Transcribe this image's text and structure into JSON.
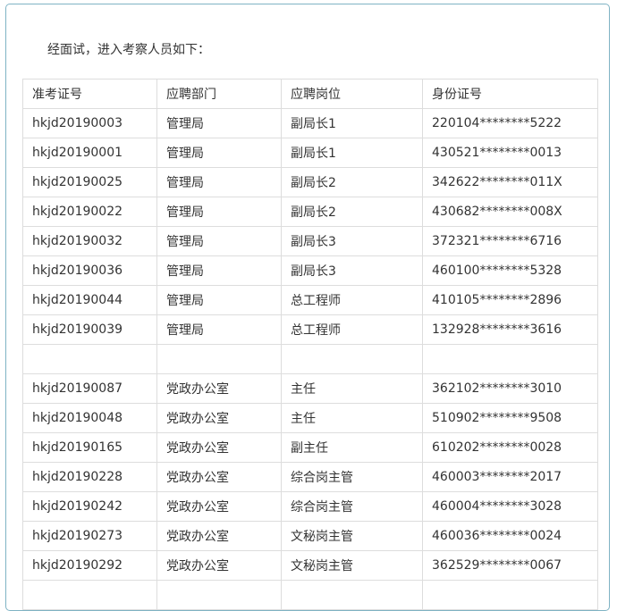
{
  "intro_text": "经面试，进入考察人员如下：",
  "table": {
    "headers": [
      "准考证号",
      "应聘部门",
      "应聘岗位",
      "身份证号"
    ],
    "rows": [
      [
        "hkjd20190003",
        "管理局",
        "副局长1",
        "220104********5222"
      ],
      [
        "hkjd20190001",
        "管理局",
        "副局长1",
        "430521********0013"
      ],
      [
        "hkjd20190025",
        "管理局",
        "副局长2",
        "342622********011X"
      ],
      [
        "hkjd20190022",
        "管理局",
        "副局长2",
        "430682********008X"
      ],
      [
        "hkjd20190032",
        "管理局",
        "副局长3",
        "372321********6716"
      ],
      [
        "hkjd20190036",
        "管理局",
        "副局长3",
        "460100********5328"
      ],
      [
        "hkjd20190044",
        "管理局",
        "总工程师",
        "410105********2896"
      ],
      [
        "hkjd20190039",
        "管理局",
        "总工程师",
        "132928********3616"
      ],
      [
        "",
        "",
        "",
        ""
      ],
      [
        "hkjd20190087",
        "党政办公室",
        "主任",
        "362102********3010"
      ],
      [
        "hkjd20190048",
        "党政办公室",
        "主任",
        "510902********9508"
      ],
      [
        "hkjd20190165",
        "党政办公室",
        "副主任",
        "610202********0028"
      ],
      [
        "hkjd20190228",
        "党政办公室",
        "综合岗主管",
        "460003********2017"
      ],
      [
        "hkjd20190242",
        "党政办公室",
        "综合岗主管",
        "460004********3028"
      ],
      [
        "hkjd20190273",
        "党政办公室",
        "文秘岗主管",
        "460036********0024"
      ],
      [
        "hkjd20190292",
        "党政办公室",
        "文秘岗主管",
        "362529********0067"
      ],
      [
        "",
        "",
        "",
        ""
      ]
    ]
  }
}
